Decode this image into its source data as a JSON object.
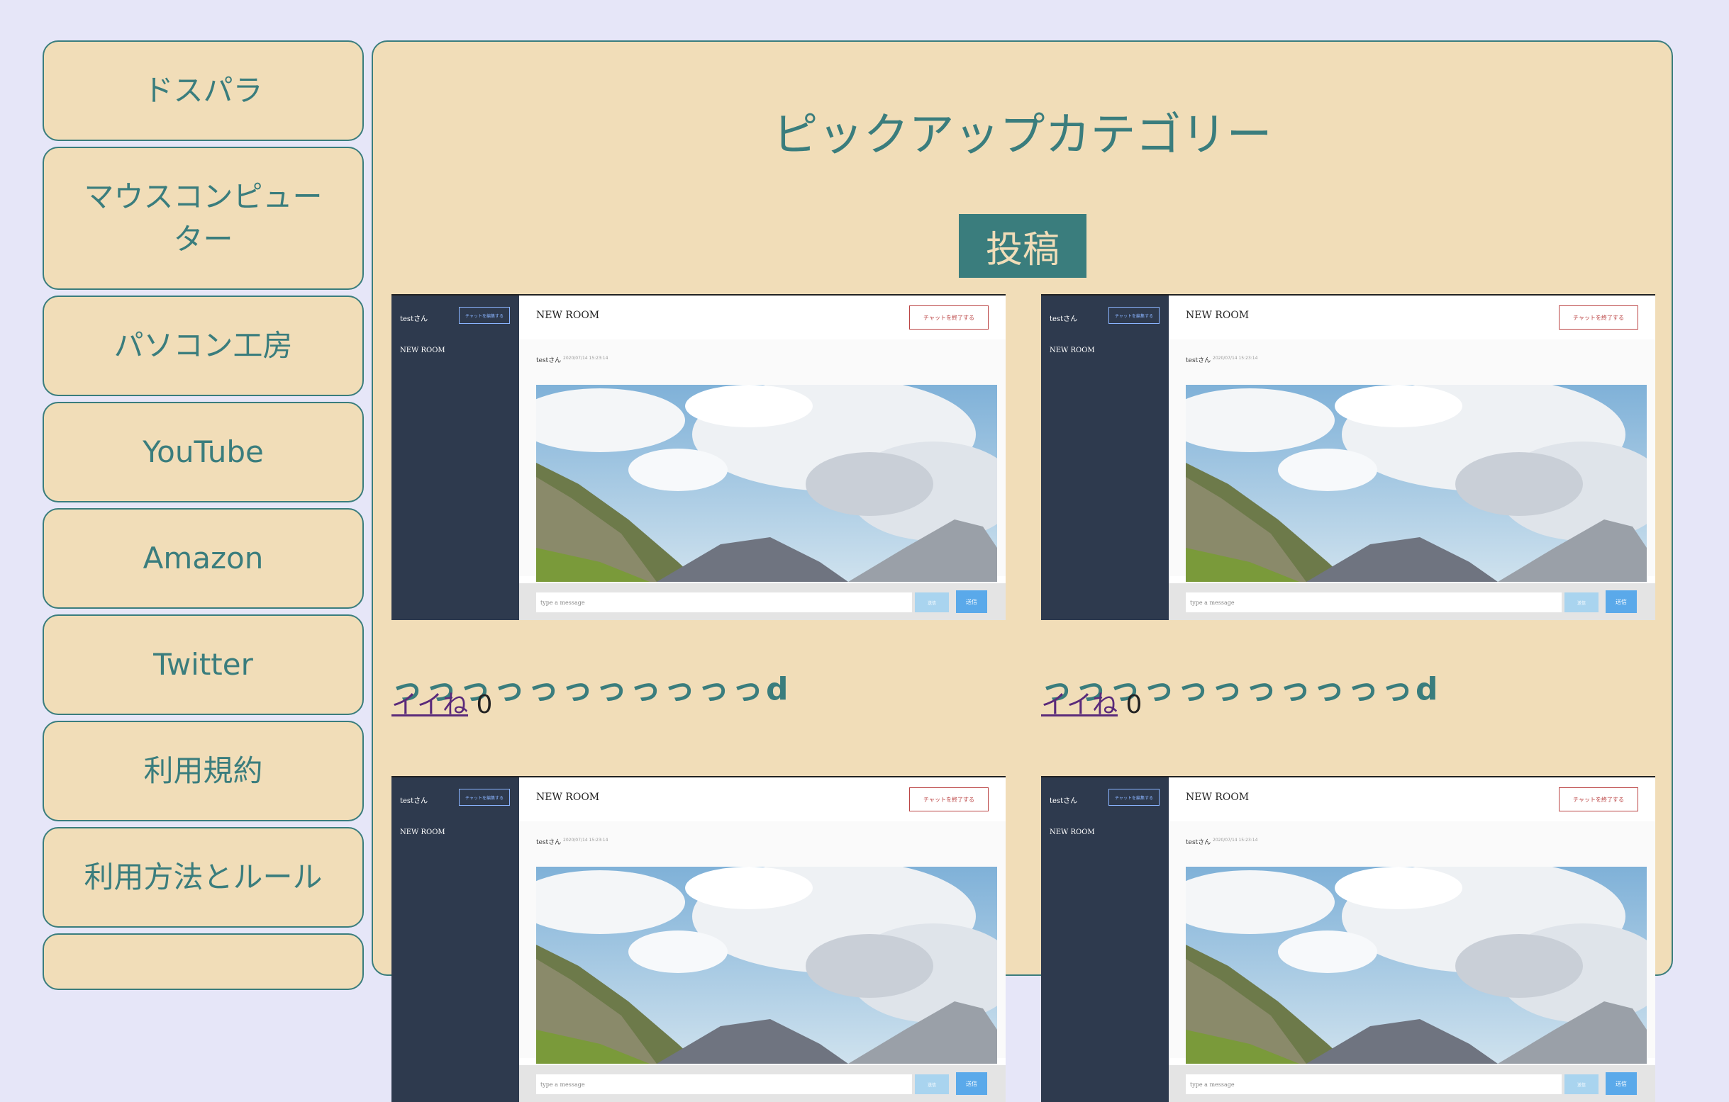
{
  "sidebar": {
    "items": [
      {
        "label": "ドスパラ"
      },
      {
        "label": "マウスコンピューター"
      },
      {
        "label": "パソコン工房"
      },
      {
        "label": "YouTube"
      },
      {
        "label": "Amazon"
      },
      {
        "label": "Twitter"
      },
      {
        "label": "利用規約"
      },
      {
        "label": "利用方法とルール"
      },
      {
        "label": ""
      }
    ]
  },
  "main": {
    "title": "ピックアップカテゴリー",
    "post_button": "投稿",
    "posts": [
      {
        "title": "っっっっっっっっっっっd",
        "like_label": "イイね",
        "like_count": "0"
      },
      {
        "title": "っっっっっっっっっっっd",
        "like_label": "イイね",
        "like_count": "0"
      },
      {
        "title": "",
        "like_label": "",
        "like_count": ""
      },
      {
        "title": "",
        "like_label": "",
        "like_count": ""
      }
    ]
  },
  "thumbnail": {
    "user": "testさん",
    "edit_button": "チャットを編集する",
    "room_name": "NEW ROOM",
    "end_button": "チャットを終了する",
    "message_user": "testさん",
    "message_time": "2020/07/14 15:23:14",
    "input_placeholder": "type a message",
    "send_label": "送信"
  },
  "colors": {
    "background": "#e6e6f8",
    "panel": "#f1ddb8",
    "accent": "#3a7d7d",
    "link": "#5a2a7a"
  }
}
